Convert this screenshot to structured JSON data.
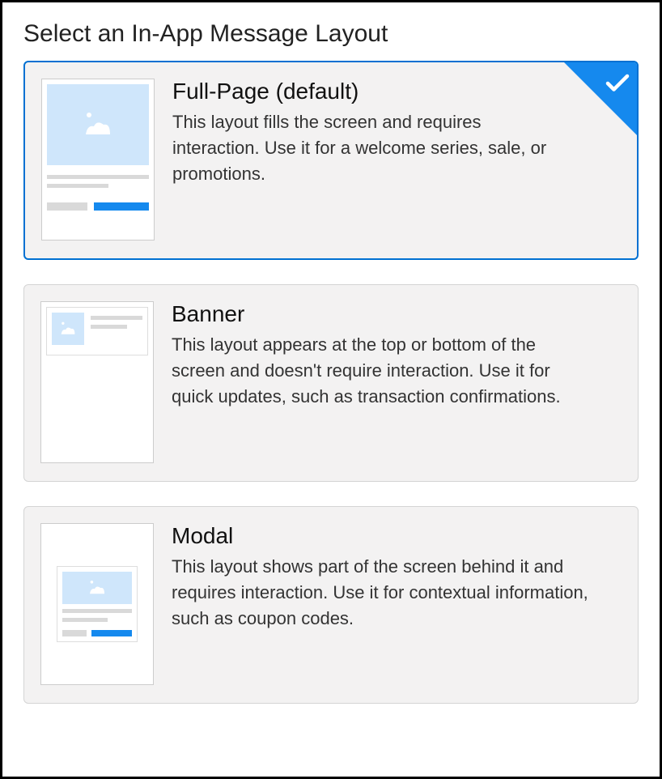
{
  "heading": "Select an In-App Message Layout",
  "options": [
    {
      "title": "Full-Page (default)",
      "desc": "This layout fills the screen and requires interaction. Use it for a welcome series, sale, or promotions.",
      "selected": true
    },
    {
      "title": "Banner",
      "desc": "This layout appears at the top or bottom of the screen and doesn't require interaction. Use it for quick updates, such as transaction confirmations.",
      "selected": false
    },
    {
      "title": "Modal",
      "desc": "This layout shows part of the screen behind it and requires interaction. Use it for contextual information, such as coupon codes.",
      "selected": false
    }
  ]
}
